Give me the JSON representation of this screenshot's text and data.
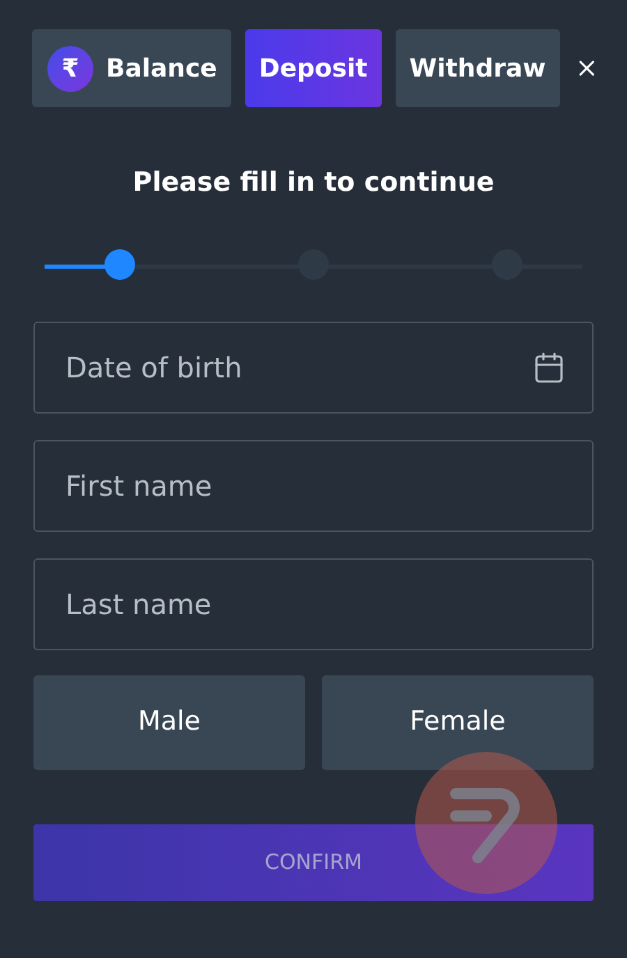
{
  "tabs": [
    {
      "label": "Balance",
      "kind": "balance",
      "currency": "₹",
      "selected": false
    },
    {
      "label": "Deposit",
      "kind": "plain",
      "selected": true
    },
    {
      "label": "Withdraw",
      "kind": "plain",
      "selected": false
    }
  ],
  "heading": "Please fill in to continue",
  "steps": [
    {
      "selected": true
    },
    {
      "selected": false
    },
    {
      "selected": false
    }
  ],
  "fields": [
    {
      "placeholder": "Date of birth",
      "kind": "date"
    },
    {
      "placeholder": "First name",
      "kind": "text"
    },
    {
      "placeholder": "Last name",
      "kind": "text"
    }
  ],
  "gender_options": [
    {
      "label": "Male",
      "selected": false
    },
    {
      "label": "Female",
      "selected": false
    }
  ],
  "confirm": {
    "label": "CONFIRM",
    "disabled": true
  }
}
